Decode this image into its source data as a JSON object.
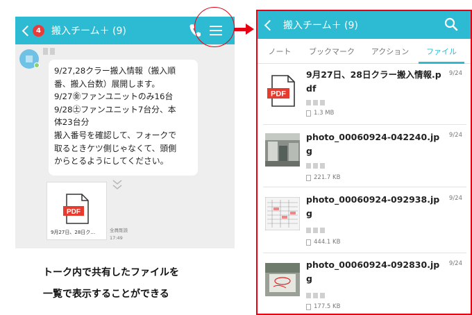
{
  "chat": {
    "badge_count": "4",
    "title": "搬入チーム＋ (9)",
    "message": "9/27,28クラー搬入情報（搬入順\n番、搬入台数）展開します。\n9/27㊎ファンユニットのみ16台\n9/28㊏ファンユニット7台分、本\n体23台分\n搬入番号を確認して、フォークで\n取るときケツ側じゃなくて、頭側\nからとるようにしてください。",
    "attachment_name": "9月27日、28日ク…",
    "read_status": "全員既読",
    "send_time": "17:49"
  },
  "caption": {
    "line1": "トーク内で共有したファイルを",
    "line2": "一覧で表示することができる"
  },
  "files_screen": {
    "title": "搬入チーム＋ (9)",
    "tabs": [
      "ノート",
      "ブックマーク",
      "アクション",
      "ファイル"
    ],
    "active_tab": "ファイル",
    "files": [
      {
        "name": "9月27日、28日クラー搬入情報.pdf",
        "date": "9/24",
        "size": "1.3 MB",
        "thumb": "pdf-icon"
      },
      {
        "name": "photo_00060924-042240.jpg",
        "date": "9/24",
        "size": "221.7 KB",
        "thumb": "photo-thumbnail"
      },
      {
        "name": "photo_00060924-092938.jpg",
        "date": "9/24",
        "size": "444.1 KB",
        "thumb": "spreadsheet-thumbnail"
      },
      {
        "name": "photo_00060924-092830.jpg",
        "date": "9/24",
        "size": "177.5 KB",
        "thumb": "photo-thumbnail"
      }
    ]
  },
  "pdf_label": "PDF",
  "colors": {
    "header": "#2cbbd3",
    "highlight": "#e60012",
    "pdf_red": "#e63c2f",
    "badge": "#e83b3b"
  }
}
